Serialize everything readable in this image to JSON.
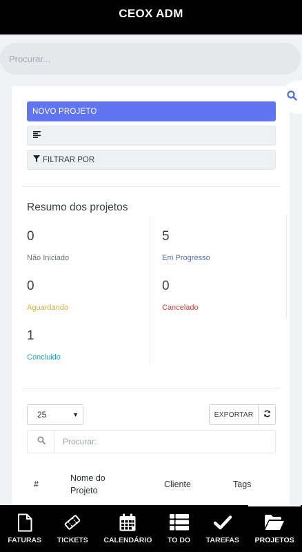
{
  "header": {
    "title": "CEOX ADM"
  },
  "search": {
    "placeholder": "Procurar..."
  },
  "actions": {
    "new_project": "NOVO PROJETO",
    "filter": "FILTRAR POR"
  },
  "summary": {
    "title": "Resumo dos projetos",
    "stats": [
      {
        "value": "0",
        "label": "Não Iniciado",
        "color": "#6b6f78"
      },
      {
        "value": "5",
        "label": "Em Progresso",
        "color": "#5b6fb5"
      },
      {
        "value": "0",
        "label": "Aguardando",
        "color": "#e0b21b"
      },
      {
        "value": "0",
        "label": "Cancelado",
        "color": "#d44040"
      },
      {
        "value": "1",
        "label": "Concluido",
        "color": "#23a5a8"
      }
    ]
  },
  "table": {
    "page_size": "25",
    "export_label": "EXPORTAR",
    "search_placeholder": "Procurar:",
    "columns": [
      "#",
      "Nome do Projeto",
      "Cliente",
      "Tags"
    ]
  },
  "bottom_nav": {
    "items": [
      {
        "label": "FATURAS",
        "icon": "file-icon"
      },
      {
        "label": "TICKETS",
        "icon": "ticket-icon"
      },
      {
        "label": "CALENDÁRIO",
        "icon": "calendar-icon"
      },
      {
        "label": "TO DO",
        "icon": "list-icon"
      },
      {
        "label": "TAREFAS",
        "icon": "check-icon"
      },
      {
        "label": "PROJETOS",
        "icon": "folder-open-icon"
      }
    ],
    "active": "PROJETOS"
  },
  "colors": {
    "primary": "#6275f0",
    "topbar": "#000000"
  }
}
